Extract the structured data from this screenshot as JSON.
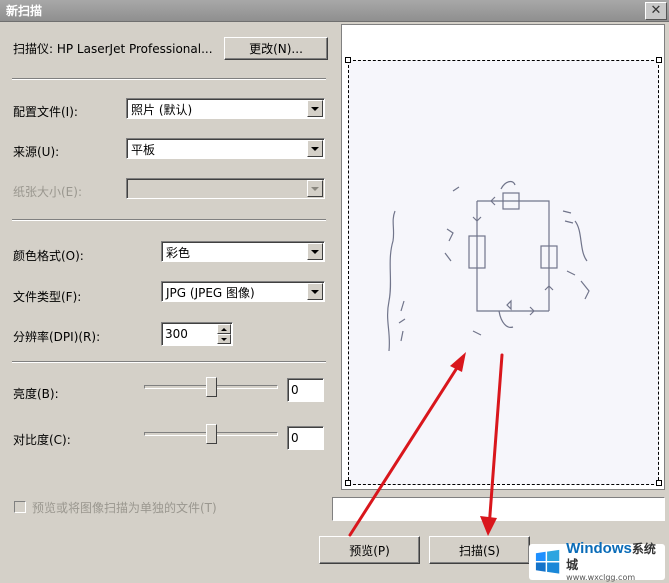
{
  "window": {
    "title": "新扫描",
    "close_symbol": "✕"
  },
  "scanner": {
    "label": "扫描仪: HP LaserJet Professional...",
    "change_button": "更改(N)..."
  },
  "profile": {
    "label": "配置文件(I):",
    "value": "照片 (默认)"
  },
  "source": {
    "label": "来源(U):",
    "value": "平板"
  },
  "paper_size": {
    "label": "纸张大小(E):",
    "value": ""
  },
  "color_format": {
    "label": "颜色格式(O):",
    "value": "彩色"
  },
  "file_type": {
    "label": "文件类型(F):",
    "value": "JPG (JPEG 图像)"
  },
  "resolution": {
    "label": "分辨率(DPI)(R):",
    "value": "300"
  },
  "brightness": {
    "label": "亮度(B):",
    "value": "0",
    "level": 0.5
  },
  "contrast": {
    "label": "对比度(C):",
    "value": "0",
    "level": 0.5
  },
  "separate_files": {
    "label": "预览或将图像扫描为单独的文件(T)",
    "checked": false
  },
  "buttons": {
    "preview": "预览(P)",
    "scan": "扫描(S)"
  },
  "watermark": {
    "brand": "Windows",
    "suffix": "系统城",
    "url": "www.wxclgg.com"
  },
  "colors": {
    "annotation_arrow": "#d9161c",
    "dialog_bg": "#d4d0c8",
    "titlebar": "#999999"
  }
}
